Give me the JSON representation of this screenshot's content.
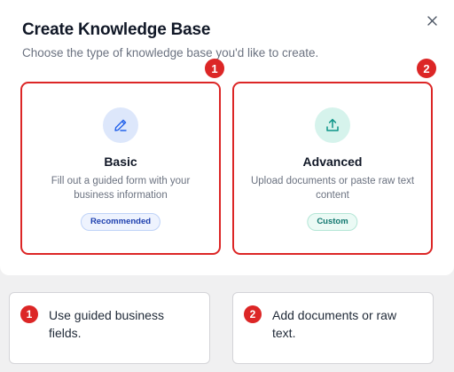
{
  "dialog": {
    "title": "Create Knowledge Base",
    "subtitle": "Choose the type of knowledge base you'd like to create."
  },
  "cards": [
    {
      "title": "Basic",
      "description": "Fill out a guided form with your business information",
      "badge": "Recommended",
      "icon": "pencil-icon",
      "accent": "#2563eb"
    },
    {
      "title": "Advanced",
      "description": "Upload documents or paste raw text content",
      "badge": "Custom",
      "icon": "upload-icon",
      "accent": "#0d9488"
    }
  ],
  "markers": [
    "1",
    "2"
  ],
  "notes": [
    {
      "number": "1",
      "text": "Use guided business fields."
    },
    {
      "number": "2",
      "text": "Add documents or raw text."
    }
  ],
  "colors": {
    "highlight": "#dc2626",
    "basic_icon_bg": "#dde7fb",
    "advanced_icon_bg": "#d6f3ec"
  }
}
